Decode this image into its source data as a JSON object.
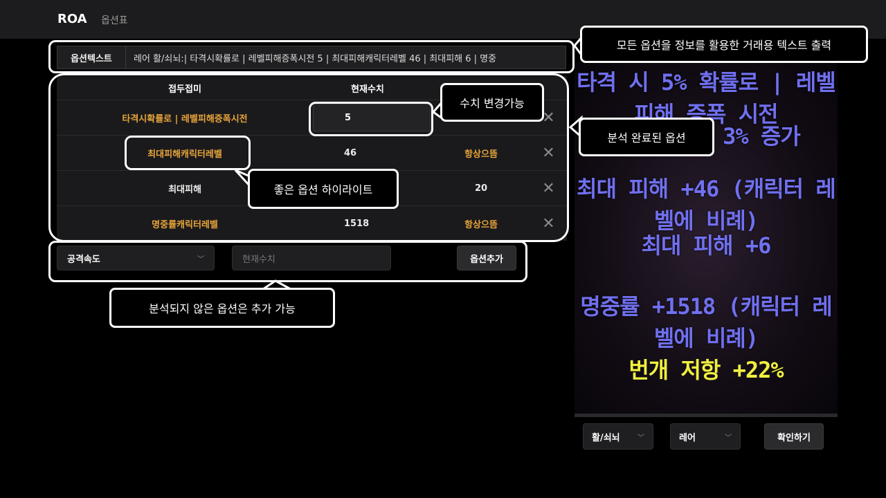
{
  "header": {
    "logo": "ROA",
    "nav_link": "옵션표"
  },
  "option_text": {
    "label": "옵션텍스트",
    "value": "레어 활/쇠뇌:| 타격시확률로 | 레벨피해증폭시전 5 | 최대피해캐릭터레벨 46 | 최대피해 6 | 명중"
  },
  "table": {
    "headers": [
      "접두접미",
      "현재수치",
      ""
    ],
    "rows": [
      {
        "name": "타격시확률로 | 레벨피해증폭시전",
        "value": "5",
        "extra": "",
        "name_color": "gold"
      },
      {
        "name": "최대피해캐릭터레벨",
        "value": "46",
        "extra": "항상으뜸",
        "name_color": "gold"
      },
      {
        "name": "최대피해",
        "value": "",
        "extra": "20",
        "name_color": "white"
      },
      {
        "name": "명중률캐릭터레벨",
        "value": "1518",
        "extra": "항상으뜸",
        "name_color": "gold"
      }
    ],
    "delete_icon": "close-icon"
  },
  "add_option": {
    "select_value": "공격속도",
    "input_placeholder": "현재수치",
    "button_label": "옵션추가"
  },
  "item_image": {
    "lines": [
      {
        "text": "타격 시 5% 확률로 | 레벨 피해 증폭 시전",
        "color": "blue"
      },
      {
        "text": "3% 증가",
        "color": "blue"
      },
      {
        "text": "최대 피해 +46 (캐릭터 레벨에 비례)",
        "color": "blue"
      },
      {
        "text": "최대 피해 +6",
        "color": "blue"
      },
      {
        "text": "명중률 +1518 (캐릭터 레벨에 비례)",
        "color": "blue"
      },
      {
        "text": "번개 저항 +22%",
        "color": "yellow"
      }
    ]
  },
  "bottom_controls": {
    "type_select": "활/쇠뇌",
    "rarity_select": "레어",
    "confirm_label": "확인하기"
  },
  "annotations": {
    "text_output": "모든 옵션을 정보를 활용한 거래용 텍스트 출력",
    "value_change": "수치 변경가능",
    "analyzed": "분석 완료된 옵션",
    "highlight": "좋은 옵션 하이라이트",
    "unanalyzed": "분석되지 않은 옵션은 추가 가능"
  },
  "colors": {
    "gold": "#e8a53a",
    "white": "#ececec",
    "item_blue": "#7070f0",
    "item_yellow": "#f0f040"
  }
}
